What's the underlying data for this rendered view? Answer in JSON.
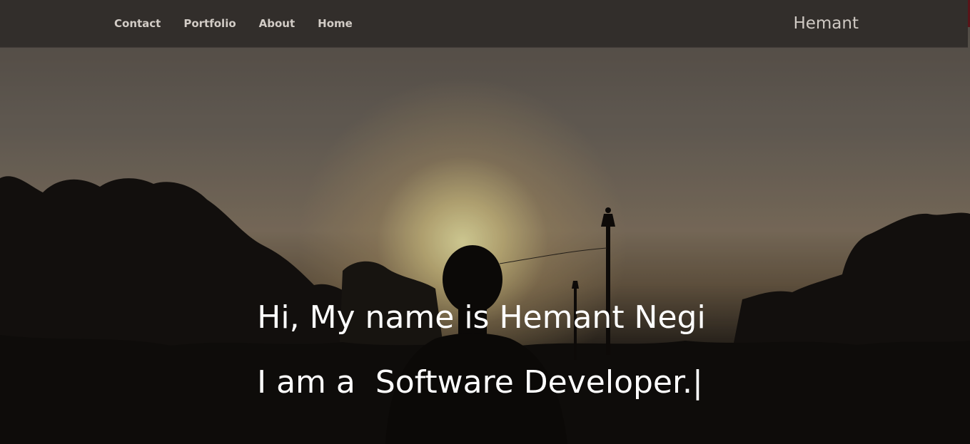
{
  "nav": {
    "links": [
      {
        "label": "Contact"
      },
      {
        "label": "Portfolio"
      },
      {
        "label": "About"
      },
      {
        "label": "Home"
      }
    ],
    "brand": "Hemant"
  },
  "hero": {
    "greeting": "Hi, My name is Hemant Negi",
    "role_prefix": "I am a ",
    "role": "Software Developer.",
    "cursor": "|"
  },
  "colors": {
    "navbar_bg": "#322e2b",
    "nav_text": "#d2ccc6",
    "hero_text": "#ffffff",
    "sun_glow": "#eee8a8"
  },
  "background": {
    "image_subject": "sunset silhouette of a person in a crowd with trees and street lamps"
  }
}
